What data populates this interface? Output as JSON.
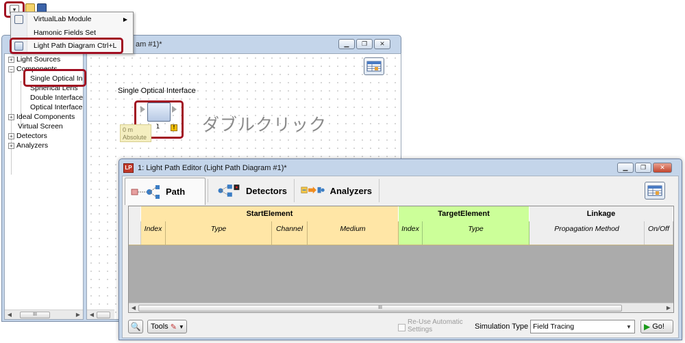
{
  "back_window": {
    "title": "am #1)*",
    "tree": {
      "items": [
        {
          "label": "Light Sources",
          "toggle": "+"
        },
        {
          "label": "Components",
          "toggle": "−"
        },
        {
          "label": "Single Optical In"
        },
        {
          "label": "Spherical Lens"
        },
        {
          "label": "Double Interface"
        },
        {
          "label": "Optical Interface"
        },
        {
          "label": "Ideal Components",
          "toggle": "+"
        },
        {
          "label": "Virtual Screen"
        },
        {
          "label": "Detectors",
          "toggle": "+"
        },
        {
          "label": "Analyzers",
          "toggle": "+"
        }
      ]
    },
    "canvas": {
      "component_title": "Single Optical Interface",
      "component_index": "1",
      "position_value": "0 m",
      "position_mode": "Absolute",
      "warning_glyph": "!",
      "annotation": "ダブルクリック"
    }
  },
  "dropdown_menu": {
    "items": [
      {
        "label": "VirtualLab Module",
        "shortcut": "",
        "submenu": "▶"
      },
      {
        "label": "Hamonic Fields Set",
        "shortcut": ""
      },
      {
        "label": "Light Path Diagram",
        "shortcut": "Ctrl+L"
      }
    ]
  },
  "front_window": {
    "title": "1: Light Path Editor (Light Path Diagram #1)*",
    "app_icon_text": "LP",
    "tabs": [
      {
        "label": "Path"
      },
      {
        "label": "Detectors"
      },
      {
        "label": "Analyzers"
      }
    ],
    "grid": {
      "groups": [
        {
          "label": "StartElement",
          "color": "#ffe6a6"
        },
        {
          "label": "TargetElement",
          "color": "#ccff99"
        },
        {
          "label": "Linkage",
          "color": "#eeeeee"
        }
      ],
      "columns": [
        "Index",
        "Type",
        "Channel",
        "Medium",
        "Index",
        "Type",
        "Propagation Method",
        "On/Off"
      ]
    },
    "bottom_bar": {
      "tools_label": "Tools",
      "reuse_label_1": "Re-Use Automatic",
      "reuse_label_2": "Settings",
      "sim_type_label": "Simulation Type :",
      "sim_type_value": "Field Tracing",
      "go_label": "Go!"
    }
  },
  "colors": {
    "highlight": "#a10d21",
    "start_bg": "#ffe6a6",
    "target_bg": "#ccff99",
    "linkage_bg": "#eeeeee",
    "window_frame": "#c4d5ea"
  },
  "scroll_thumb": "III"
}
